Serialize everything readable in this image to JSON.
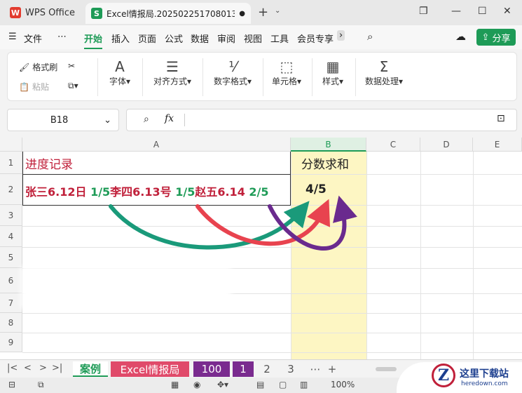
{
  "titlebar": {
    "app_tab": "WPS Office",
    "doc_tab": "Excel情报局.202502251708013",
    "doc_tab_modified": "●",
    "new_tab": "+",
    "tab_menu": "⌄"
  },
  "menu": {
    "file": "文件",
    "more": "⋯",
    "tabs": [
      "开始",
      "插入",
      "页面",
      "公式",
      "数据",
      "审阅",
      "视图",
      "工具",
      "会员专享"
    ],
    "share": "分享"
  },
  "ribbon": {
    "format_painter": "格式刷",
    "paste": "粘贴",
    "font": "字体",
    "align": "对齐方式",
    "number_format": "数字格式",
    "cells": "单元格",
    "styles": "样式",
    "data_processing": "数据处理"
  },
  "formula_bar": {
    "name_box": "B18",
    "fx": "fx",
    "formula": ""
  },
  "sheet": {
    "columns": [
      "A",
      "B",
      "C",
      "D",
      "E"
    ],
    "rows": [
      "1",
      "2",
      "3",
      "4",
      "5",
      "6",
      "7",
      "8",
      "9"
    ],
    "A1": "进度记录",
    "B1": "分数求和",
    "B2": "4/5",
    "A2": {
      "p1": "张三6.12日 ",
      "s1": "1/5",
      "p2": "李四6.13号 ",
      "s2": "1/5",
      "p3": "赵五6.14 ",
      "s3": "2/5"
    },
    "arrow_colors": [
      "#1a9a7a",
      "#e8434f",
      "#6a2a8e"
    ]
  },
  "sheet_tabs": {
    "active": "案例",
    "tabs": [
      "Excel情报局",
      "100",
      "1",
      "2",
      "3"
    ],
    "more": "⋯",
    "add": "+"
  },
  "status": {
    "zoom": "100%"
  },
  "watermark": {
    "logo": "Z",
    "title": "这里下载站",
    "url": "heredown.com"
  }
}
